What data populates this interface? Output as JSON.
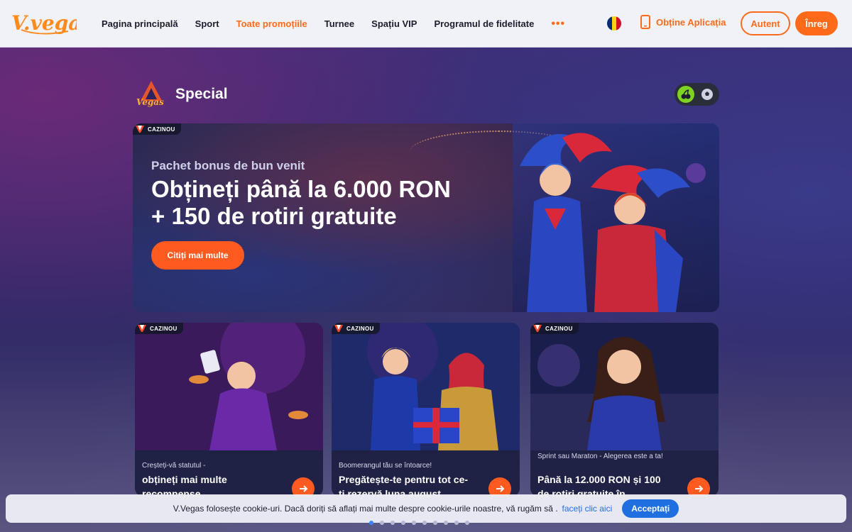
{
  "header": {
    "logo_text": "V.vegas",
    "nav": [
      {
        "label": "Pagina principală",
        "active": false
      },
      {
        "label": "Sport",
        "active": false
      },
      {
        "label": "Toate promoțiile",
        "active": true
      },
      {
        "label": "Turnee",
        "active": false
      },
      {
        "label": "Spațiu VIP",
        "active": false
      },
      {
        "label": "Programul de fidelitate",
        "active": false
      }
    ],
    "more_icon": "•••",
    "language_flag": "romania-flag-icon",
    "app_label": "Obține Aplicația",
    "login_label": "Autent",
    "register_label": "Înreg"
  },
  "section": {
    "logo_text": "Vegas",
    "title": "Special",
    "toggle": [
      "casino-icon",
      "sport-ball-icon"
    ]
  },
  "hero": {
    "tag": "CAZINOU",
    "subtitle": "Pachet bonus de bun venit",
    "title_line1": "Obțineți până la 6.000 RON",
    "title_line2": "+ 150 de rotiri gratuite",
    "button": "Citiți mai multe"
  },
  "cards": [
    {
      "tag": "CAZINOU",
      "small": "Creșteți-vă statutul -",
      "title": "obțineți mai multe recompense"
    },
    {
      "tag": "CAZINOU",
      "small": "Boomerangul tău se întoarce!",
      "title": "Pregătește-te pentru tot ce-ți rezervă luna august"
    },
    {
      "tag": "CAZINOU",
      "small": "Sprint sau Maraton - Alegerea este a ta!",
      "title": "Până la 12.000 RON și 100 de rotiri gratuite în"
    }
  ],
  "cookie": {
    "text": "V.Vegas folosește cookie-uri. Dacă doriți să aflați mai multe despre cookie-urile noastre, vă rugăm să .",
    "link": "faceți clic aici",
    "accept": "Acceptați"
  },
  "pager": {
    "count": 10,
    "active_index": 0
  },
  "colors": {
    "accent": "#ff6a1a",
    "link": "#1f6fe0",
    "header_bg": "#f1f2f7"
  }
}
